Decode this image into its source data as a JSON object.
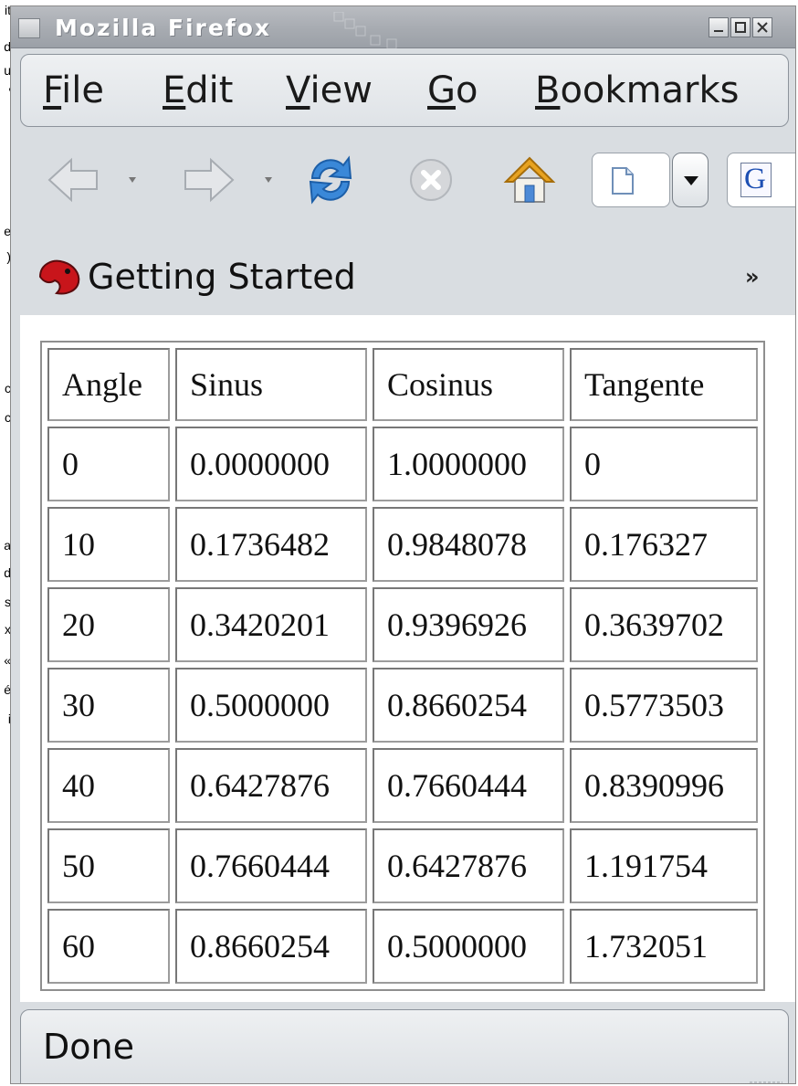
{
  "background_window": {
    "edge_chars": [
      "it",
      "d",
      "u",
      "'",
      "e",
      ")",
      "c",
      "c",
      "a",
      "d",
      "s",
      "x",
      "«",
      "é",
      "i"
    ]
  },
  "window": {
    "title": "Mozilla Firefox",
    "controls": {
      "minimize_icon": "minimize-icon",
      "maximize_icon": "maximize-icon",
      "close_icon": "close-icon"
    }
  },
  "menubar": {
    "file": {
      "mnemonic": "F",
      "rest": "ile"
    },
    "edit": {
      "mnemonic": "E",
      "rest": "dit"
    },
    "view": {
      "mnemonic": "V",
      "rest": "iew"
    },
    "go": {
      "mnemonic": "G",
      "rest": "o"
    },
    "bookmarks": {
      "mnemonic": "B",
      "rest": "ookmarks"
    }
  },
  "navbar": {
    "icons": [
      "back-arrow-icon",
      "forward-arrow-icon",
      "reload-icon",
      "stop-icon",
      "home-icon",
      "page-icon",
      "dropdown-arrow-icon",
      "google-search-icon"
    ],
    "search_engine_letter": "G"
  },
  "bookmarks_bar": {
    "items": [
      {
        "label": "Getting Started",
        "icon": "firefox-bookmark-icon"
      }
    ],
    "overflow": "»"
  },
  "colors": {
    "chrome_bg": "#d9dde1",
    "titlebar": "#a7abb1",
    "reload_blue": "#3a88d8",
    "home_roof": "#e8a321"
  },
  "table": {
    "headers": [
      "Angle",
      "Sinus",
      "Cosinus",
      "Tangente"
    ],
    "rows": [
      [
        "0",
        "0.0000000",
        "1.0000000",
        "0"
      ],
      [
        "10",
        "0.1736482",
        "0.9848078",
        "0.176327"
      ],
      [
        "20",
        "0.3420201",
        "0.9396926",
        "0.3639702"
      ],
      [
        "30",
        "0.5000000",
        "0.8660254",
        "0.5773503"
      ],
      [
        "40",
        "0.6427876",
        "0.7660444",
        "0.8390996"
      ],
      [
        "50",
        "0.7660444",
        "0.6427876",
        "1.191754"
      ],
      [
        "60",
        "0.8660254",
        "0.5000000",
        "1.732051"
      ]
    ]
  },
  "statusbar": {
    "text": "Done"
  }
}
